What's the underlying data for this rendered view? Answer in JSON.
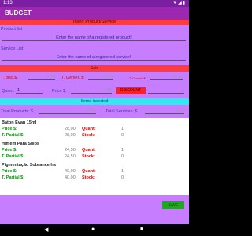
{
  "status": {
    "time": "1:13",
    "icons": "▼◢▮"
  },
  "app": {
    "title": "BUDGET"
  },
  "sections": {
    "insert": "Insert Product/Service",
    "sale": "Sale",
    "items": "Items inserted"
  },
  "product": {
    "label": "Product list",
    "placeholder": "Enter the name of a registered product!"
  },
  "service": {
    "label": "Service List",
    "placeholder": "Enter the name of a registered service!"
  },
  "sale": {
    "t_disc_label": "T. disc.$:",
    "t_disc_value": "0,00",
    "t_genier_label": "T. Genier. $:",
    "t_genier_value": "92,50",
    "t_current_label": "T. Current $:",
    "t_current_value": "92,50",
    "quant_label": "Quant:",
    "quant_value": "1",
    "price_label": "Price $:",
    "price_value": "0,00",
    "discount_button": "DISCOUNT",
    "discount_value": "0"
  },
  "totals": {
    "products_label": "Total Products: $",
    "products_value": "92,50",
    "services_label": "Total Services: $",
    "services_value": "0,00"
  },
  "items": [
    {
      "name": "Baton Evan 15ml",
      "price": "28,00",
      "quant": "1",
      "partial": "28,00",
      "stock": "0"
    },
    {
      "name": "Himem Para Silios",
      "price": "24,50",
      "quant": "1",
      "partial": "24,50",
      "stock": "0"
    },
    {
      "name": "Pigmentação Sobrancelha",
      "price": "40,00",
      "quant": "1",
      "partial": "40,00",
      "stock": "0"
    }
  ],
  "labels": {
    "price": "Price $:",
    "partial": "T. Partial $:",
    "quant": "Quant:",
    "stock": "Stock:"
  },
  "actions": {
    "save": "SAVE"
  },
  "nav": {
    "back": "◀",
    "home": "●",
    "recent": "■"
  }
}
